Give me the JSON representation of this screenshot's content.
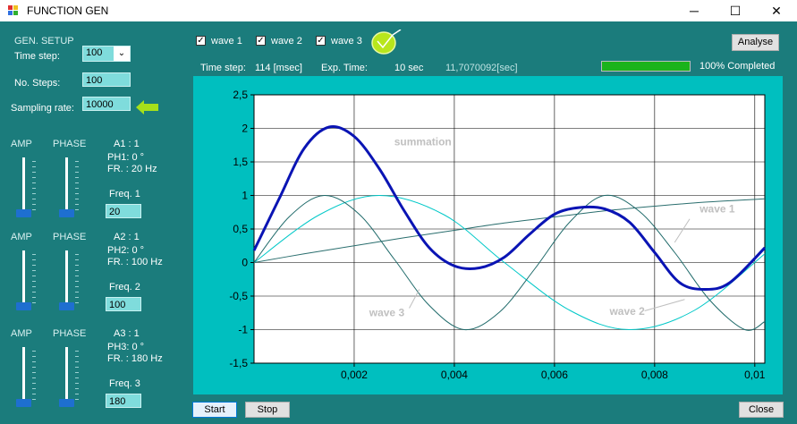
{
  "window": {
    "title": "FUNCTION GEN",
    "minimize": "─",
    "maximize": "☐",
    "close": "✕"
  },
  "setup": {
    "header": "GEN. SETUP",
    "time_step_label": "Time step:",
    "time_step_value": "100",
    "steps_label": "No. Steps:",
    "steps_value": "100",
    "sampling_label": "Sampling rate:",
    "sampling_value": "10000"
  },
  "channels": [
    {
      "amp_label": "AMP",
      "phase_label": "PHASE",
      "amp_text": "A1 : 1",
      "ph_text": "PH1: 0 °",
      "fr_text": "FR. : 20 Hz",
      "freq_label": "Freq. 1",
      "freq_value": "20",
      "amp_level": 0.0,
      "phase_level": 0.0
    },
    {
      "amp_label": "AMP",
      "phase_label": "PHASE",
      "amp_text": "A2 : 1",
      "ph_text": "PH2: 0 °",
      "fr_text": "FR. : 100 Hz",
      "freq_label": "Freq. 2",
      "freq_value": "100",
      "amp_level": 0.0,
      "phase_level": 0.0
    },
    {
      "amp_label": "AMP",
      "phase_label": "PHASE",
      "amp_text": "A3 : 1",
      "ph_text": "PH3: 0 °",
      "fr_text": "FR. : 180 Hz",
      "freq_label": "Freq. 3",
      "freq_value": "180",
      "amp_level": 0.0,
      "phase_level": 0.0
    }
  ],
  "toolbar": {
    "wave1": "wave 1",
    "wave2": "wave 2",
    "wave3": "wave 3",
    "analyse": "Analyse"
  },
  "status": {
    "time_step_label": "Time step:",
    "time_step_value": "114 [msec]",
    "exp_label": "Exp. Time:",
    "exp_value": "10 sec",
    "elapsed": "11,7070092[sec]",
    "progress": 1.0,
    "progress_text": "100% Completed"
  },
  "buttons": {
    "start": "Start",
    "stop": "Stop",
    "close": "Close"
  },
  "colors": {
    "panel": "#1b7c7c",
    "chart_bg": "#00bfbf",
    "summation": "#0a14b4",
    "wave1": "#2a6e6e",
    "wave2": "#00c8c8",
    "wave3": "#1f6a6a",
    "progress": "#1bb31b"
  },
  "chart_data": {
    "type": "line",
    "xlim": [
      0,
      0.0102
    ],
    "ylim": [
      -1.5,
      2.5
    ],
    "xticks": [
      "0,002",
      "0,004",
      "0,006",
      "0,008",
      "0,01"
    ],
    "yticks": [
      "2,5",
      "2",
      "1,5",
      "1",
      "0,5",
      "0",
      "-0,5",
      "-1",
      "-1,5"
    ],
    "grid": true,
    "annotations": [
      "summation",
      "wave 1",
      "wave 2",
      "wave 3"
    ],
    "series": [
      {
        "name": "wave 1",
        "x": [
          0,
          0.001,
          0.002,
          0.003,
          0.004,
          0.005,
          0.006,
          0.007,
          0.008,
          0.009,
          0.0102
        ],
        "y": [
          0,
          0.13,
          0.25,
          0.37,
          0.48,
          0.59,
          0.68,
          0.77,
          0.84,
          0.9,
          0.95
        ]
      },
      {
        "name": "wave 2",
        "x": [
          0,
          0.0013,
          0.0025,
          0.0038,
          0.005,
          0.0063,
          0.0075,
          0.0088,
          0.0102
        ],
        "y": [
          0,
          0.71,
          1,
          0.71,
          0,
          -0.71,
          -1,
          -0.71,
          0.13
        ]
      },
      {
        "name": "wave 3",
        "x": [
          0,
          0.0007,
          0.0014,
          0.0021,
          0.0028,
          0.0035,
          0.0042,
          0.0049,
          0.0056,
          0.0063,
          0.007,
          0.0077,
          0.0084,
          0.0091,
          0.0098,
          0.0102
        ],
        "y": [
          0,
          0.68,
          1,
          0.72,
          0.05,
          -0.64,
          -1,
          -0.74,
          -0.1,
          0.6,
          1,
          0.76,
          0.15,
          -0.56,
          -1,
          -0.88
        ]
      },
      {
        "name": "summation",
        "x": [
          0,
          0.0005,
          0.001,
          0.0015,
          0.002,
          0.0025,
          0.003,
          0.0035,
          0.004,
          0.0045,
          0.005,
          0.0055,
          0.006,
          0.0065,
          0.007,
          0.0075,
          0.008,
          0.0085,
          0.009,
          0.0095,
          0.0102
        ],
        "y": [
          0.18,
          0.95,
          1.7,
          2.02,
          1.88,
          1.4,
          0.77,
          0.22,
          -0.05,
          -0.08,
          0.08,
          0.42,
          0.72,
          0.82,
          0.8,
          0.6,
          0.15,
          -0.3,
          -0.4,
          -0.3,
          0.22
        ]
      }
    ]
  }
}
